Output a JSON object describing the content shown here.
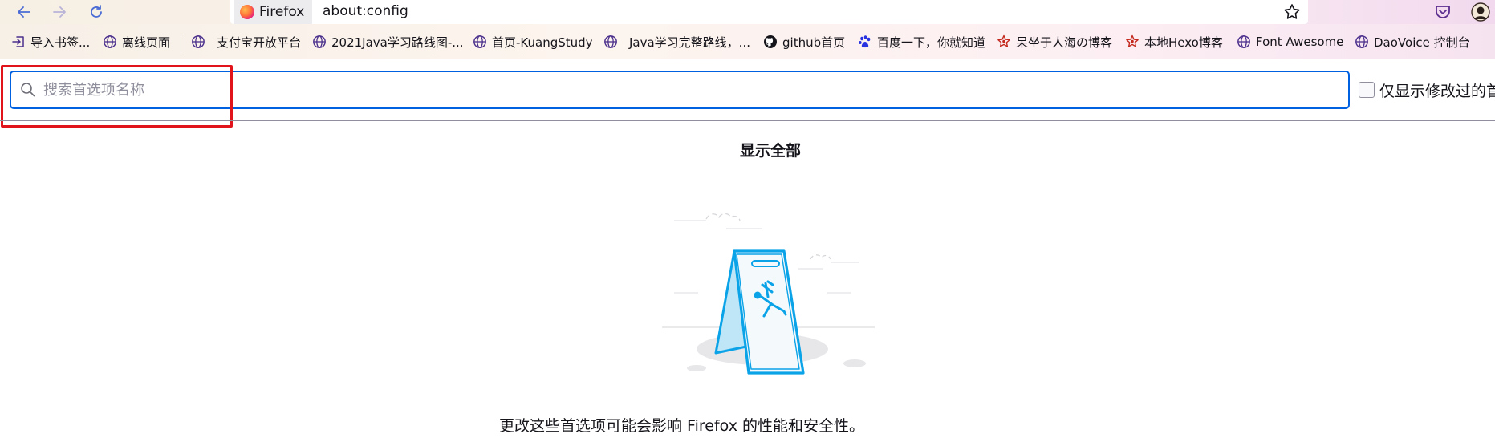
{
  "browser": {
    "identity_label": "Firefox",
    "url": "about:config"
  },
  "bookmarks": [
    {
      "label": "导入书签...",
      "icon": "import-icon"
    },
    {
      "label": "离线页面",
      "icon": "globe-icon"
    },
    {
      "label": "支付宝开放平台",
      "icon": "globe-icon"
    },
    {
      "label": "2021Java学习路线图-...",
      "icon": "globe-icon"
    },
    {
      "label": "首页-KuangStudy",
      "icon": "globe-icon"
    },
    {
      "label": "Java学习完整路线，...",
      "icon": "globe-icon"
    },
    {
      "label": "github首页",
      "icon": "github-icon"
    },
    {
      "label": "百度一下，你就知道",
      "icon": "baidu-paw-icon"
    },
    {
      "label": "呆坐于人海の博客",
      "icon": "star-badge-icon"
    },
    {
      "label": "本地Hexo博客",
      "icon": "star-badge-icon"
    },
    {
      "label": "Font Awesome",
      "icon": "globe-icon"
    },
    {
      "label": "DaoVoice 控制台",
      "icon": "globe-icon"
    }
  ],
  "config": {
    "search_placeholder": "搜索首选项名称",
    "show_modified_label": "仅显示修改过的首",
    "show_all_label": "显示全部",
    "warning_text": "更改这些首选项可能会影响 Firefox 的性能和安全性。"
  },
  "colors": {
    "accent": "#0061e0",
    "highlight": "#e0141a",
    "illustration_blue": "#0aa3e8"
  }
}
